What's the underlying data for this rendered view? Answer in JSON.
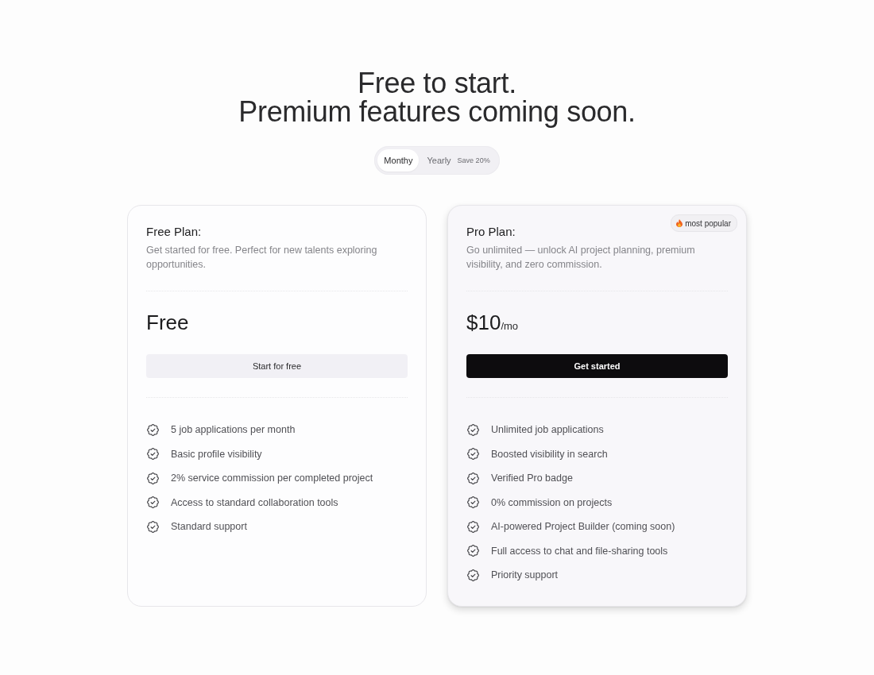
{
  "headline": {
    "lines": [
      "Free to start.",
      "Premium features coming soon."
    ]
  },
  "billing_toggle": {
    "options": [
      {
        "label": "Monthy",
        "selected": true
      },
      {
        "label": "Yearly",
        "selected": false,
        "note": "Save 20%"
      }
    ]
  },
  "plans": [
    {
      "title": "Free Plan:",
      "description": "Get started for free. Perfect for new talents exploring opportunities.",
      "price": "Free",
      "featured": false,
      "button": {
        "label": "Start for free",
        "kind": "secondary"
      },
      "features": [
        "5 job applications per month",
        "Basic profile visibility",
        "2% service commission per completed project",
        "Access to standard collaboration tools",
        "Standard support"
      ]
    },
    {
      "title": "Pro Plan:",
      "description": "Go unlimited — unlock AI project planning, premium visibility, and zero commission.",
      "price": "$10",
      "period": "/mo",
      "featured": true,
      "badge": "most popular",
      "button": {
        "label": "Get started",
        "kind": "primary"
      },
      "features": [
        "Unlimited job applications",
        "Boosted visibility in search",
        "Verified Pro badge",
        "0% commission on projects",
        "AI-powered Project Builder (coming soon)",
        "Full access to chat and file-sharing tools",
        "Priority support"
      ]
    }
  ]
}
